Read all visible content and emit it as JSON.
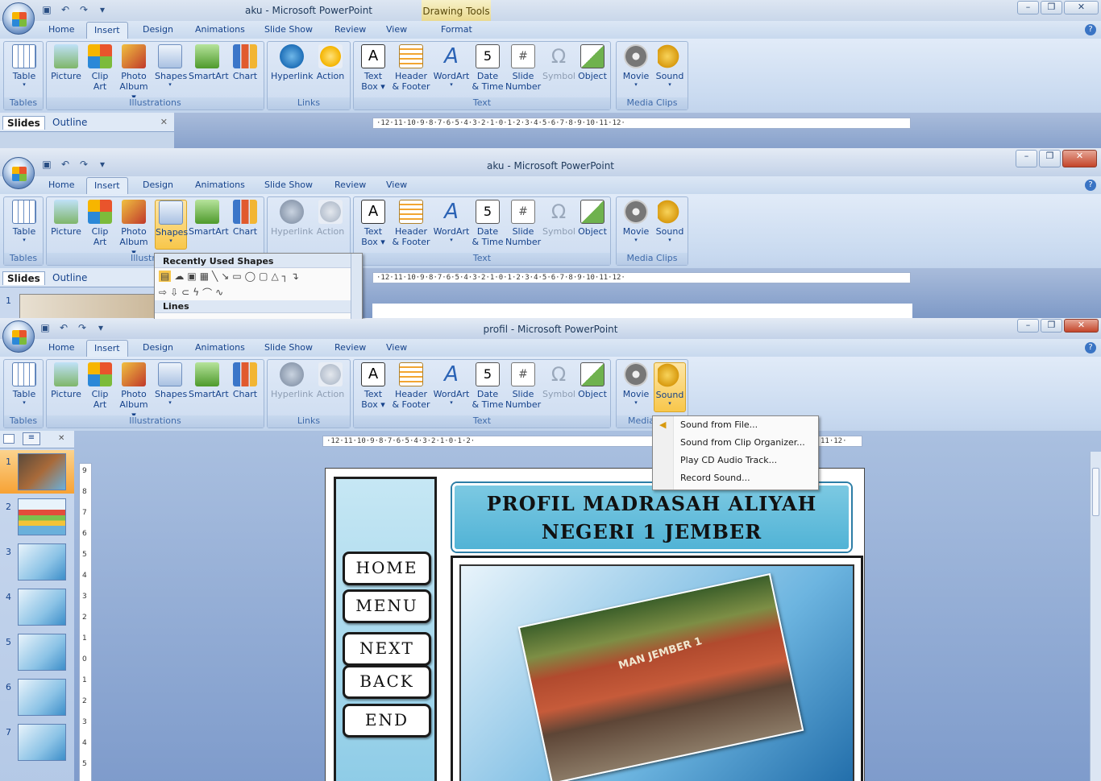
{
  "window1": {
    "title": "aku - Microsoft PowerPoint",
    "contextual_tab_group": "Drawing Tools",
    "tabs": [
      "Home",
      "Insert",
      "Design",
      "Animations",
      "Slide Show",
      "Review",
      "View",
      "Format"
    ],
    "pane_tabs": {
      "slides": "Slides",
      "outline": "Outline"
    }
  },
  "window2": {
    "title": "aku - Microsoft PowerPoint",
    "tabs": [
      "Home",
      "Insert",
      "Design",
      "Animations",
      "Slide Show",
      "Review",
      "View"
    ],
    "pane_tabs": {
      "slides": "Slides",
      "outline": "Outline"
    },
    "slide_number": "1",
    "shapes_menu": {
      "header": "Recently Used Shapes",
      "section2": "Lines"
    }
  },
  "window3": {
    "title": "profil - Microsoft PowerPoint",
    "tabs": [
      "Home",
      "Insert",
      "Design",
      "Animations",
      "Slide Show",
      "Review",
      "View"
    ],
    "sound_menu": [
      "Sound from File...",
      "Sound from Clip Organizer...",
      "Play CD Audio Track...",
      "Record Sound..."
    ],
    "thumbnail_numbers": [
      "1",
      "2",
      "3",
      "4",
      "5",
      "6",
      "7"
    ],
    "vruler_numbers": [
      "9",
      "8",
      "7",
      "6",
      "5",
      "4",
      "3",
      "2",
      "1",
      "0",
      "1",
      "2",
      "3",
      "4",
      "5"
    ]
  },
  "ribbon": {
    "table": {
      "l1": "Table"
    },
    "picture": {
      "l1": "Picture"
    },
    "clipart": {
      "l1": "Clip",
      "l2": "Art"
    },
    "photoalbum": {
      "l1": "Photo",
      "l2": "Album"
    },
    "shapes": {
      "l1": "Shapes"
    },
    "smartart": {
      "l1": "SmartArt"
    },
    "chart": {
      "l1": "Chart"
    },
    "hyperlink": {
      "l1": "Hyperlink"
    },
    "action": {
      "l1": "Action"
    },
    "textbox": {
      "l1": "Text",
      "l2": "Box"
    },
    "headerfooter": {
      "l1": "Header",
      "l2": "& Footer"
    },
    "wordart": {
      "l1": "WordArt"
    },
    "datetime": {
      "l1": "Date",
      "l2": "& Time"
    },
    "slidenumber": {
      "l1": "Slide",
      "l2": "Number"
    },
    "symbol": {
      "l1": "Symbol"
    },
    "object": {
      "l1": "Object"
    },
    "movie": {
      "l1": "Movie"
    },
    "sound": {
      "l1": "Sound"
    },
    "groups": {
      "tables": "Tables",
      "illustrations": "Illustrations",
      "links": "Links",
      "text": "Text",
      "media": "Media Clips",
      "illustrations_cut": "Illustr",
      "media_cut": "Media"
    }
  },
  "ruler_text": "·12·11·10·9·8·7·6·5·4·3·2·1·0·1·2·3·4·5·6·7·8·9·10·11·12·",
  "ruler_text3": "·12·11·10·9·8·7·6·5·4·3·2·1·0·1·2·",
  "ruler_text3b": "11·12·",
  "slide": {
    "title_line1": "PROFIL MADRASAH ALIYAH",
    "title_line2": "NEGERI 1 JEMBER",
    "nav": [
      "HOME",
      "MENU",
      "NEXT",
      "BACK",
      "END"
    ],
    "photo_sign": "MAN JEMBER 1"
  },
  "colors": {
    "accent": "#f8c74b",
    "title_bar": "#c3d2e8",
    "ribbon": "#dfe9f7",
    "slide_title": "#51b3d6"
  }
}
